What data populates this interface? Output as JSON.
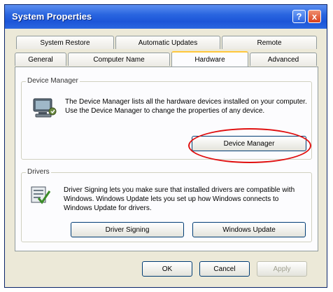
{
  "window": {
    "title": "System Properties",
    "help_label": "?",
    "close_label": "x"
  },
  "tabs": {
    "row1": [
      {
        "label": "System Restore"
      },
      {
        "label": "Automatic Updates"
      },
      {
        "label": "Remote"
      }
    ],
    "row2": [
      {
        "label": "General"
      },
      {
        "label": "Computer Name"
      },
      {
        "label": "Hardware",
        "active": true
      },
      {
        "label": "Advanced"
      }
    ]
  },
  "device_manager": {
    "group_label": "Device Manager",
    "description": "The Device Manager lists all the hardware devices installed on your computer. Use the Device Manager to change the properties of any device.",
    "button_label": "Device Manager",
    "icon": "device-manager-icon",
    "highlight_color": "#e01010"
  },
  "drivers": {
    "group_label": "Drivers",
    "description": "Driver Signing lets you make sure that installed drivers are compatible with Windows. Windows Update lets you set up how Windows connects to Windows Update for drivers.",
    "signing_button_label": "Driver Signing",
    "update_button_label": "Windows Update",
    "icon": "driver-signing-icon"
  },
  "footer": {
    "ok_label": "OK",
    "cancel_label": "Cancel",
    "apply_label": "Apply"
  },
  "colors": {
    "titlebar": "#2a66e0",
    "dialog_bg": "#ece9d8",
    "active_tab_accent": "#ffc83c"
  }
}
